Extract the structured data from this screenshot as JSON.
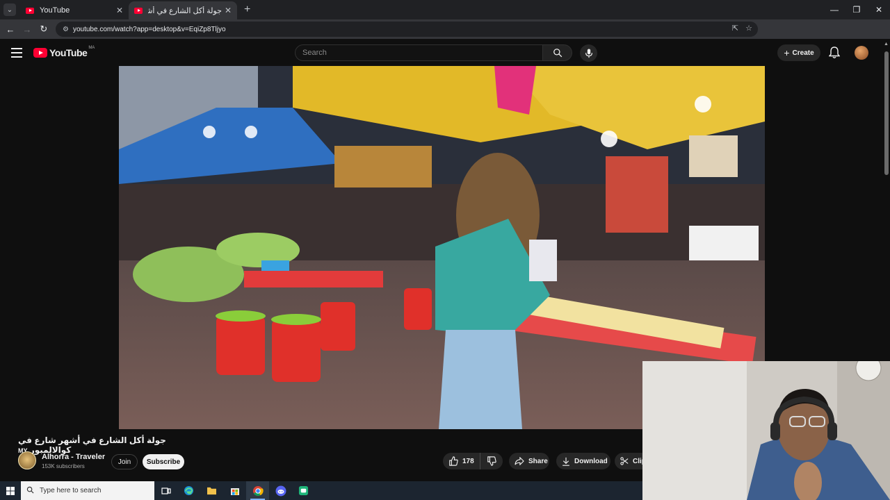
{
  "browser": {
    "tabs": [
      {
        "title": "YouTube",
        "active": false
      },
      {
        "title": "جولة أكل الشارع في أشهر شارع في",
        "active": true
      }
    ],
    "url": "youtube.com/watch?app=desktop&v=EqiZp8Tljyo",
    "window_controls": [
      "minimize",
      "restore",
      "close"
    ]
  },
  "youtube": {
    "logo_text": "YouTube",
    "region": "MA",
    "search_placeholder": "Search",
    "create_label": "Create"
  },
  "video": {
    "title": "جولة أكل الشارع في أشهر شارع في كوالالمبور 🇲🇾",
    "title_suffix": "MY",
    "title_text": "جولة أكل الشارع في أشهر شارع في كوالالمبور"
  },
  "channel": {
    "name": "Alhorra - Traveler",
    "subscribers": "153K subscribers",
    "join_label": "Join",
    "subscribe_label": "Subscribe"
  },
  "actions": {
    "likes": "178",
    "share_label": "Share",
    "download_label": "Download",
    "clip_label": "Clip"
  },
  "taskbar": {
    "search_placeholder": "Type here to search",
    "apps": [
      "task-view",
      "edge",
      "file-explorer",
      "store",
      "chrome",
      "discord",
      "app"
    ]
  },
  "colors": {
    "youtube_red": "#ff0033",
    "background": "#0f0f0f",
    "pill_bg": "#272727"
  }
}
